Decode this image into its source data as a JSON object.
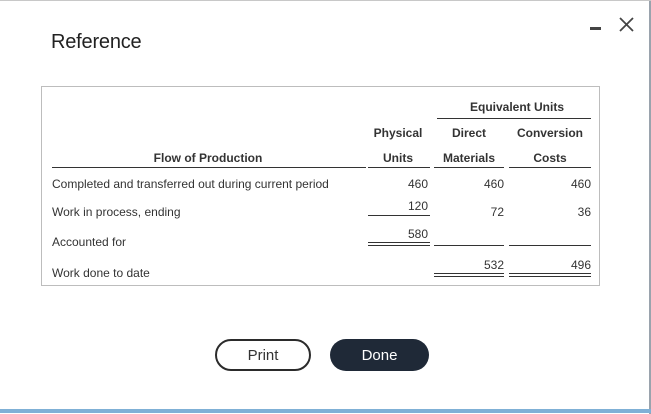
{
  "dialog": {
    "title": "Reference",
    "print_label": "Print",
    "done_label": "Done"
  },
  "table": {
    "group_header": "Equivalent Units",
    "headers": {
      "flow": "Flow of Production",
      "physical_1": "Physical",
      "physical_2": "Units",
      "direct_1": "Direct",
      "direct_2": "Materials",
      "conversion_1": "Conversion",
      "conversion_2": "Costs"
    },
    "rows": [
      {
        "label": "Completed and transferred out during current period",
        "physical": "460",
        "direct": "460",
        "conversion": "460"
      },
      {
        "label": "Work in process, ending",
        "physical": "120",
        "direct": "72",
        "conversion": "36"
      },
      {
        "label": "Accounted for",
        "physical": "580",
        "direct": "",
        "conversion": ""
      },
      {
        "label": "Work done to date",
        "physical": "",
        "direct": "532",
        "conversion": "496"
      }
    ]
  }
}
